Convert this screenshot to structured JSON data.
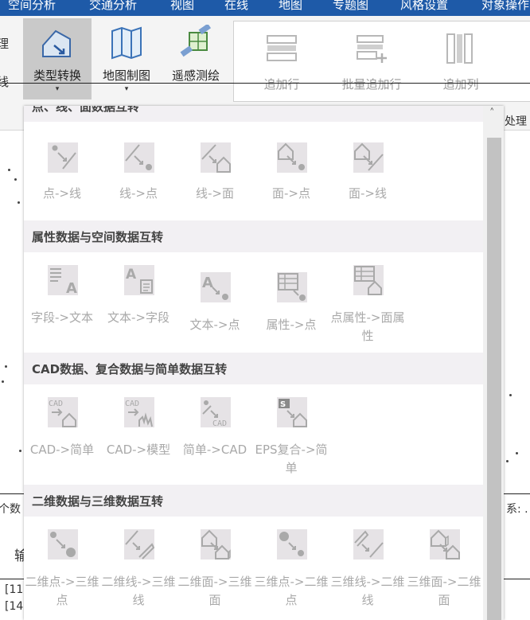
{
  "menubar": {
    "items": [
      "空间分析",
      "交通分析",
      "视图",
      "在线",
      "地图",
      "专题图",
      "风格设置",
      "对象操作"
    ]
  },
  "ribbon": {
    "left_fragments": [
      "理",
      "线"
    ],
    "buttons": [
      {
        "label": "类型转换",
        "icon": "type-convert-icon",
        "caret": "▾"
      },
      {
        "label": "地图制图",
        "icon": "map-making-icon",
        "caret": "▾"
      },
      {
        "label": "遥感测绘",
        "icon": "remote-sensing-icon"
      }
    ],
    "table_group": [
      {
        "label": "追加行",
        "icon": "append-row-icon"
      },
      {
        "label": "批量追加行",
        "icon": "batch-append-row-icon"
      },
      {
        "label": "追加列",
        "icon": "append-column-icon"
      }
    ]
  },
  "side_text": {
    "right_top": "处理",
    "left_mid": "个数",
    "right_mid": "系: .",
    "left_lower": "输",
    "output_1": "[11",
    "output_2": "[14"
  },
  "dropdown": {
    "scroll_up": "˄",
    "sections": [
      {
        "title": "点、线、面数据互转",
        "tools": [
          {
            "label": "点->线",
            "icon": "point-to-line-icon"
          },
          {
            "label": "线->点",
            "icon": "line-to-point-icon"
          },
          {
            "label": "线->面",
            "icon": "line-to-region-icon"
          },
          {
            "label": "面->点",
            "icon": "region-to-point-icon"
          },
          {
            "label": "面->线",
            "icon": "region-to-line-icon"
          }
        ]
      },
      {
        "title": "属性数据与空间数据互转",
        "tools": [
          {
            "label": "字段->文本",
            "icon": "field-to-text-icon"
          },
          {
            "label": "文本->字段",
            "icon": "text-to-field-icon"
          },
          {
            "label": "文本->点",
            "icon": "text-to-point-icon"
          },
          {
            "label": "属性->点",
            "icon": "attribute-to-point-icon"
          },
          {
            "label": "点属性->面属性",
            "icon": "point-attr-to-region-attr-icon"
          }
        ]
      },
      {
        "title": "CAD数据、复合数据与简单数据互转",
        "tools": [
          {
            "label": "CAD->简单",
            "icon": "cad-to-simple-icon"
          },
          {
            "label": "CAD->模型",
            "icon": "cad-to-model-icon"
          },
          {
            "label": "简单->CAD",
            "icon": "simple-to-cad-icon"
          },
          {
            "label": "EPS复合->简单",
            "icon": "eps-to-simple-icon"
          }
        ]
      },
      {
        "title": "二维数据与三维数据互转",
        "tools": [
          {
            "label": "二维点->三维点",
            "icon": "2d-point-to-3d-point-icon"
          },
          {
            "label": "二维线->三维线",
            "icon": "2d-line-to-3d-line-icon"
          },
          {
            "label": "二维面->三维面",
            "icon": "2d-region-to-3d-region-icon"
          },
          {
            "label": "三维点->二维点",
            "icon": "3d-point-to-2d-point-icon"
          },
          {
            "label": "三维线->二维线",
            "icon": "3d-line-to-2d-line-icon"
          },
          {
            "label": "三维面->二维面",
            "icon": "3d-region-to-2d-region-icon"
          }
        ]
      }
    ]
  }
}
